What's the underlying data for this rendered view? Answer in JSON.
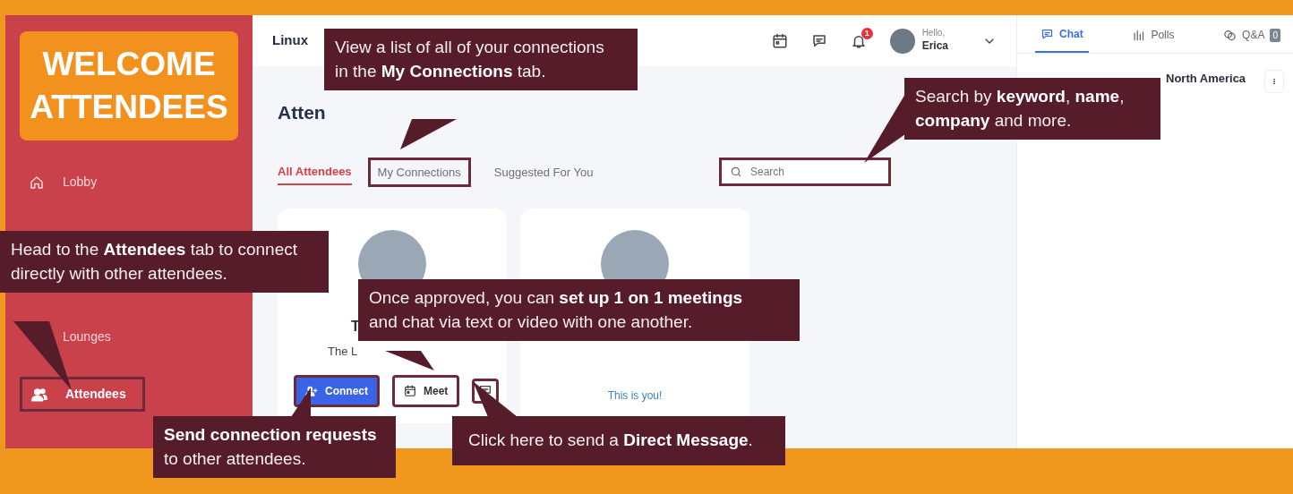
{
  "sidebar": {
    "banner": "WELCOME ATTENDEES",
    "items": [
      {
        "label": "Lobby",
        "selected": false,
        "highlighted": false
      },
      {
        "label": "Lounges",
        "selected": false,
        "highlighted": false
      },
      {
        "label": "Attendees",
        "selected": true,
        "highlighted": true
      }
    ]
  },
  "header": {
    "title": "Linux",
    "notification_count": "1",
    "greeting": "Hello,",
    "user_name": "Erica"
  },
  "page": {
    "heading": "Atten",
    "tabs": [
      {
        "label": "All Attendees",
        "selected": true,
        "highlighted": false
      },
      {
        "label": "My Connections",
        "selected": false,
        "highlighted": true
      },
      {
        "label": "Suggested For You",
        "selected": false,
        "highlighted": false
      }
    ],
    "search": {
      "placeholder": "Search",
      "highlighted": true
    }
  },
  "cards": [
    {
      "name": "T",
      "subtitle": "The L",
      "actions": [
        {
          "kind": "primary",
          "label": "Connect",
          "highlighted": true
        },
        {
          "kind": "outline",
          "label": "Meet",
          "highlighted": true
        },
        {
          "kind": "icon",
          "highlighted": true
        }
      ]
    },
    {
      "note": "This is you!"
    }
  ],
  "right_panel": {
    "tabs": [
      {
        "label": "Chat",
        "selected": true
      },
      {
        "label": "Polls",
        "selected": false
      },
      {
        "label": "Q&A",
        "selected": false,
        "count": "0"
      }
    ],
    "channel": "North America"
  },
  "callouts": [
    {
      "text": "View a list of all of your connections\nin the **My Connections** tab."
    },
    {
      "text": "Search by **keyword**, **name**,\n**company** and more."
    },
    {
      "text": "Head to the **Attendees** tab to connect\ndirectly with other attendees."
    },
    {
      "text": "Once approved, you can **set up 1 on 1 meetings**\nand chat via text or video with one another."
    },
    {
      "text": "**Send connection requests**\nto other attendees."
    },
    {
      "text": "Click here to send a **Direct Message**."
    }
  ]
}
